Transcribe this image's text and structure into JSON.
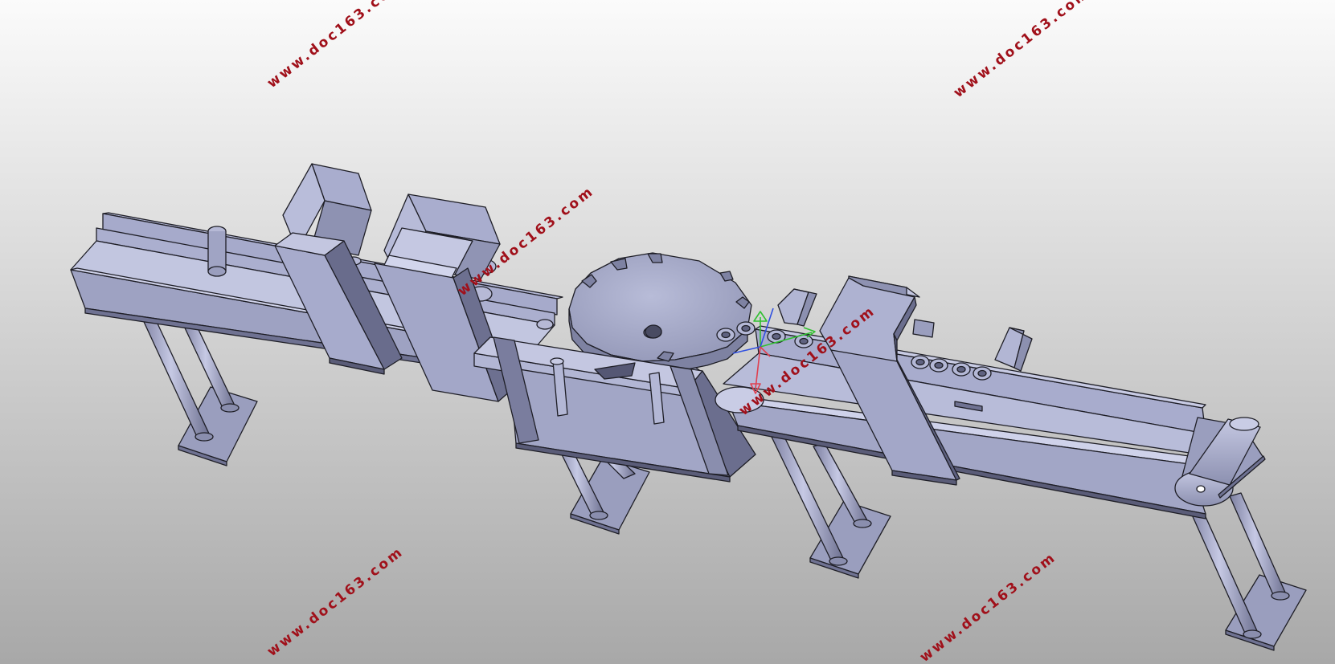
{
  "colors": {
    "background_top": "#fbfbfb",
    "background_bottom": "#a8a8a8",
    "metal_light": "#bcc0dc",
    "metal_mid": "#a2a6c6",
    "metal_dark": "#6f7292",
    "metal_shadow": "#5a5c78",
    "edge": "#1e1e26",
    "watermark": "#a0101a",
    "axis_x": "#e04050",
    "axis_y": "#30c030",
    "axis_z": "#3050e0"
  },
  "watermark": {
    "text": "www.doc163.com"
  }
}
